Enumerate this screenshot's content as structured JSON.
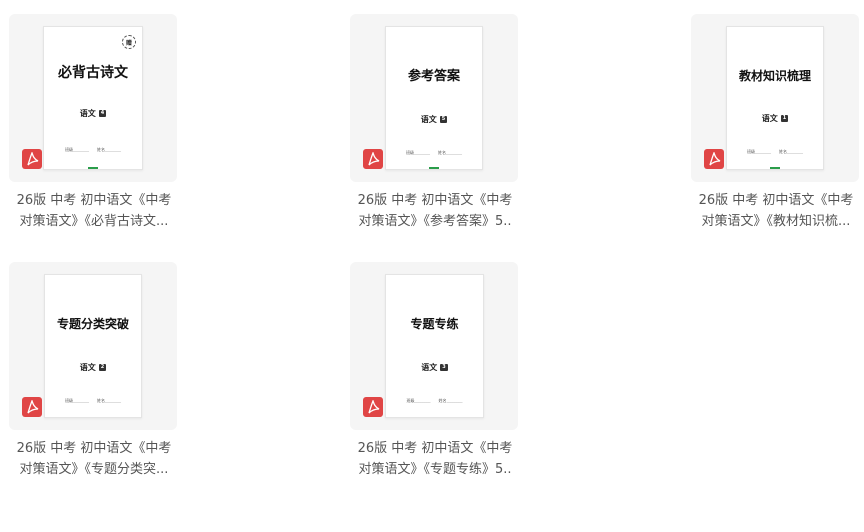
{
  "files": [
    {
      "doc_title": "必背古诗文",
      "subject": "语文",
      "volume": "4",
      "fields": [
        "班级",
        "姓名"
      ],
      "seal_char": "赠",
      "caption_line1": "26版 中考 初中语文《中考",
      "caption_line2": "对策语文》《必背古诗文..."
    },
    {
      "doc_title": "参考答案",
      "subject": "语文",
      "volume": "5",
      "fields": [
        "班级",
        "姓名"
      ],
      "caption_line1": "26版 中考 初中语文《中考",
      "caption_line2": "对策语文》《参考答案》5.."
    },
    {
      "doc_title": "教材知识梳理",
      "subject": "语文",
      "volume": "1",
      "fields": [
        "班级",
        "姓名"
      ],
      "caption_line1": "26版 中考 初中语文《中考",
      "caption_line2": "对策语文》《教材知识梳..."
    },
    {
      "doc_title": "专题分类突破",
      "subject": "语文",
      "volume": "2",
      "fields": [
        "班级",
        "姓名"
      ],
      "caption_line1": "26版 中考 初中语文《中考",
      "caption_line2": "对策语文》《专题分类突..."
    },
    {
      "doc_title": "专题专练",
      "subject": "语文",
      "volume": "3",
      "fields": [
        "班级",
        "姓名"
      ],
      "caption_line1": "26版 中考 初中语文《中考",
      "caption_line2": "对策语文》《专题专练》5.."
    }
  ],
  "icons": {
    "file_type": "pdf-icon"
  },
  "colors": {
    "pdf_badge": "#e04545",
    "thumb_bg": "#f5f5f5",
    "caption_text": "#555555"
  }
}
